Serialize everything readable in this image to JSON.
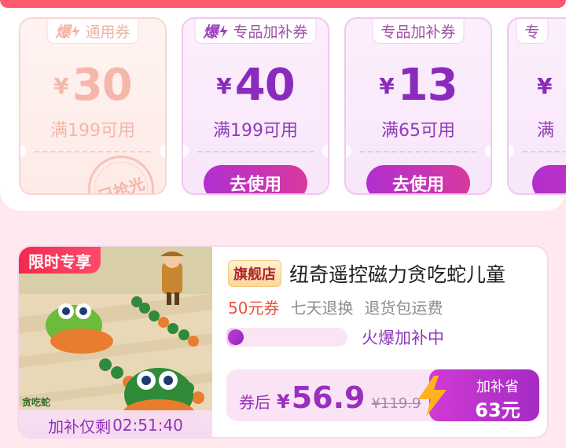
{
  "coupons": [
    {
      "tag_icon": "爆",
      "tag_label": "通用券",
      "currency": "¥",
      "amount": "30",
      "condition": "满199可用",
      "status": "sold_out",
      "stamp": "已抢光"
    },
    {
      "tag_icon": "爆",
      "tag_label": "专品加补券",
      "currency": "¥",
      "amount": "40",
      "condition": "满199可用",
      "button": "去使用"
    },
    {
      "tag_icon": "",
      "tag_label": "专品加补券",
      "currency": "¥",
      "amount": "13",
      "condition": "满65可用",
      "button": "去使用"
    },
    {
      "tag_icon": "",
      "tag_label": "专",
      "currency": "¥",
      "amount": "",
      "condition": "满",
      "button": ""
    }
  ],
  "product": {
    "ribbon": "限时专享",
    "image_caption": "贪吃蛇",
    "countdown_label": "加补仅剩",
    "countdown_time": "02:51:40",
    "store_badge": "旗舰店",
    "title": "纽奇遥控磁力贪吃蛇儿童",
    "perks": [
      "50元券",
      "七天退换",
      "退货包运费"
    ],
    "progress_label": "火爆加补中",
    "progress_fraction": 0.1,
    "price_prefix": "券后",
    "currency": "¥",
    "price": "56.9",
    "original_price": "¥119.9",
    "save_label": "加补省",
    "save_amount": "63元"
  },
  "colors": {
    "accent_purple": "#9a2fbf",
    "button_gradient_start": "#b12fd0",
    "button_gradient_end": "#d8399e",
    "ribbon_red": "#f2294e",
    "sold_out_peach": "#f6b7ab",
    "bolt_orange": "#ffb21f"
  }
}
